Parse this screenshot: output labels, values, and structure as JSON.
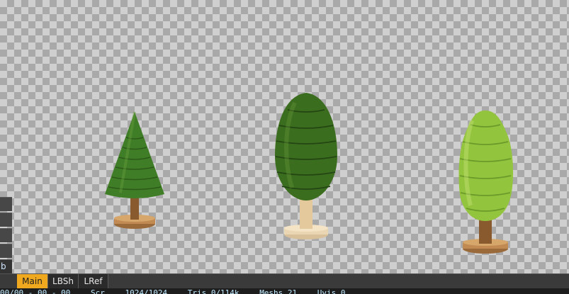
{
  "viewport": {
    "objects": [
      {
        "name": "Fir tree",
        "shape": "cone",
        "color": "#3f7d26"
      },
      {
        "name": "Oval tree dark",
        "shape": "oval",
        "color": "#3b6d1f"
      },
      {
        "name": "Oval tree light",
        "shape": "oval",
        "color": "#93c43e"
      }
    ]
  },
  "left_panel": {
    "label": "b"
  },
  "tabs": [
    "Main",
    "LBSh",
    "LRef"
  ],
  "active_tab": "Main",
  "status": {
    "frame": "00/00 - 00 - 00",
    "scene": "Scr",
    "resolution": "1024/1024",
    "tris": "Tris 0/114k",
    "meshes": "Meshs 21",
    "uv": "Uvis 0"
  },
  "colors": {
    "accent_tab": "#f0a81e",
    "status_text": "#bfe9ff"
  }
}
